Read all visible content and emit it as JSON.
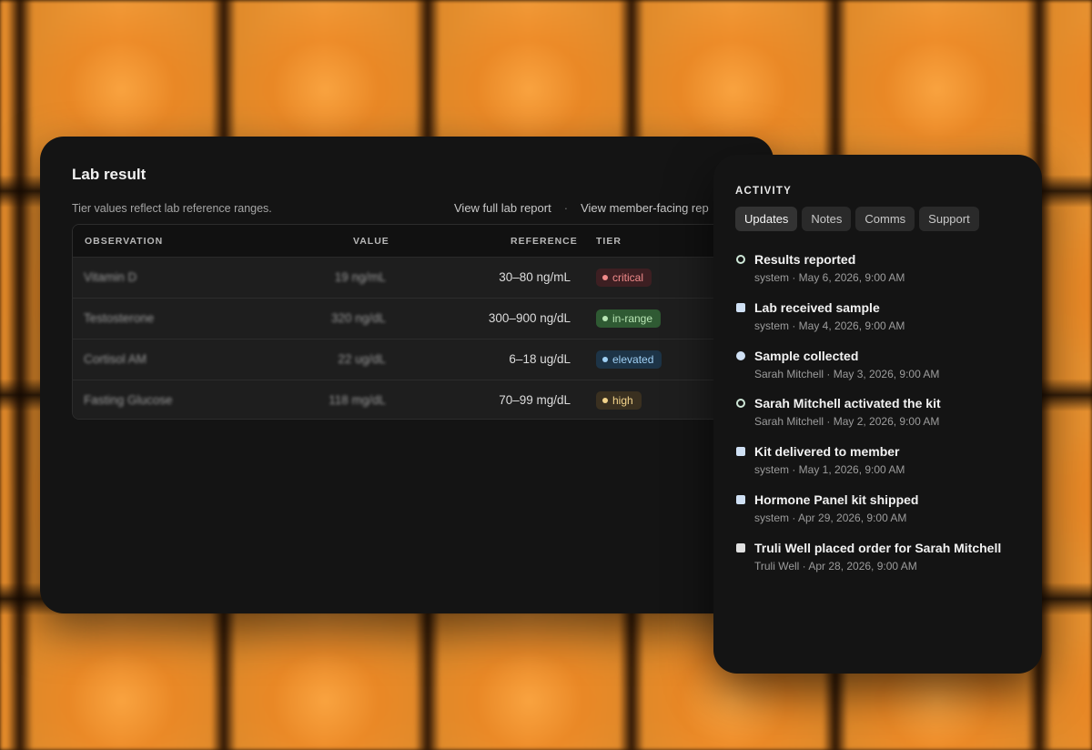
{
  "lab": {
    "title": "Lab result",
    "subtitle": "Tier values reflect lab reference ranges.",
    "link_full_report": "View full lab report",
    "link_separator": "·",
    "link_member_facing": "View member-facing rep",
    "columns": {
      "observation": "OBSERVATION",
      "value": "VALUE",
      "reference": "REFERENCE",
      "tier": "TIER"
    },
    "rows": [
      {
        "observation": "Vitamin D",
        "value": "19 ng/mL",
        "reference": "30–80 ng/mL",
        "tier": "critical",
        "tier_color": "#f08a8a",
        "tier_bg": "#3d1f22"
      },
      {
        "observation": "Testosterone",
        "value": "320 ng/dL",
        "reference": "300–900 ng/dL",
        "tier": "in-range",
        "tier_color": "#b9e6b5",
        "tier_bg": "#2f5a33"
      },
      {
        "observation": "Cortisol AM",
        "value": "22 ug/dL",
        "reference": "6–18 ug/dL",
        "tier": "elevated",
        "tier_color": "#9fd0f5",
        "tier_bg": "#1d3447"
      },
      {
        "observation": "Fasting Glucose",
        "value": "118 mg/dL",
        "reference": "70–99 mg/dL",
        "tier": "high",
        "tier_color": "#f3d38a",
        "tier_bg": "#3a3020"
      }
    ]
  },
  "activity": {
    "heading": "ACTIVITY",
    "tabs": [
      {
        "label": "Updates",
        "active": true
      },
      {
        "label": "Notes",
        "active": false
      },
      {
        "label": "Comms",
        "active": false
      },
      {
        "label": "Support",
        "active": false
      }
    ],
    "events": [
      {
        "title": "Results reported",
        "meta": "system · May 6, 2026, 9:00 AM",
        "marker": "ring-icon"
      },
      {
        "title": "Lab received sample",
        "meta": "system · May 4, 2026, 9:00 AM",
        "marker": "square-icon"
      },
      {
        "title": "Sample collected",
        "meta": "Sarah Mitchell · May 3, 2026, 9:00 AM",
        "marker": "dot-icon"
      },
      {
        "title": "Sarah Mitchell activated the kit",
        "meta": "Sarah Mitchell · May 2, 2026, 9:00 AM",
        "marker": "ring-icon"
      },
      {
        "title": "Kit delivered to member",
        "meta": "system · May 1, 2026, 9:00 AM",
        "marker": "square-icon"
      },
      {
        "title": "Hormone Panel kit shipped",
        "meta": "system · Apr 29, 2026, 9:00 AM",
        "marker": "square-icon"
      },
      {
        "title": "Truli Well placed order for Sarah Mitchell",
        "meta": "Truli Well · Apr 28, 2026, 9:00 AM",
        "marker": "square-gray-icon"
      }
    ]
  }
}
